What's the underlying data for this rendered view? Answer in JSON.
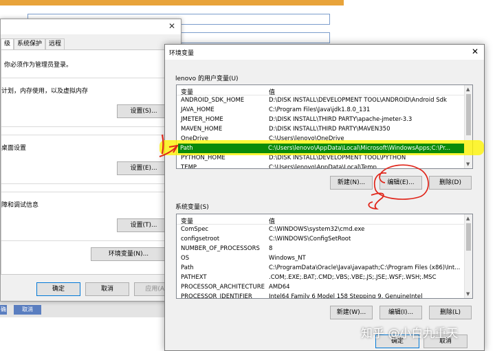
{
  "background": {
    "btn_a": "确",
    "btn_b": "取消"
  },
  "sysprop": {
    "tabs": [
      "级",
      "系统保护",
      "远程"
    ],
    "admin_note": "你必须作为管理员登录。",
    "perf_text": "计划，内存使用，以及虚拟内存",
    "settings1": "设置(S)...",
    "profile_text": "桌面设置",
    "settings2": "设置(E)...",
    "startup_text": "障和调试信息",
    "settings3": "设置(T)...",
    "envvars_btn": "环境变量(N)...",
    "ok": "确定",
    "cancel": "取消",
    "apply": "应用(A)"
  },
  "env": {
    "title": "环境变量",
    "user_label": "lenovo 的用户变量(U)",
    "col_var": "变量",
    "col_val": "值",
    "user_vars": [
      {
        "name": "ANDROID_SDK_HOME",
        "value": "D:\\DISK INSTALL\\DEVELOPMENT TOOL\\ANDROID\\Android Sdk"
      },
      {
        "name": "JAVA_HOME",
        "value": "C:\\Program Files\\Java\\jdk1.8.0_131"
      },
      {
        "name": "JMETER_HOME",
        "value": "D:\\DISK INSTALL\\THIRD PARTY\\apache-jmeter-3.3"
      },
      {
        "name": "MAVEN_HOME",
        "value": "D:\\DISK INSTALL\\THIRD PARTY\\MAVEN350"
      },
      {
        "name": "OneDrive",
        "value": "C:\\Users\\lenovo\\OneDrive"
      },
      {
        "name": "Path",
        "value": "C:\\Users\\lenovo\\AppData\\Local\\Microsoft\\WindowsApps;C:\\Pr..."
      },
      {
        "name": "PYTHON_HOME",
        "value": "D:\\DISK INSTALL\\DEVELOPMENT TOOL\\PYTHON"
      },
      {
        "name": "TEMP",
        "value": "C:\\Users\\lenovo\\AppData\\Local\\Temp"
      }
    ],
    "user_new": "新建(N)...",
    "user_edit": "编辑(E)...",
    "user_delete": "删除(D)",
    "sys_label": "系统变量(S)",
    "sys_vars": [
      {
        "name": "ComSpec",
        "value": "C:\\WINDOWS\\system32\\cmd.exe"
      },
      {
        "name": "configsetroot",
        "value": "C:\\WINDOWS\\ConfigSetRoot"
      },
      {
        "name": "NUMBER_OF_PROCESSORS",
        "value": "8"
      },
      {
        "name": "OS",
        "value": "Windows_NT"
      },
      {
        "name": "Path",
        "value": "C:\\ProgramData\\Oracle\\Java\\javapath;C:\\Program Files (x86)\\Int..."
      },
      {
        "name": "PATHEXT",
        "value": ".COM;.EXE;.BAT;.CMD;.VBS;.VBE;.JS;.JSE;.WSF;.WSH;.MSC"
      },
      {
        "name": "PROCESSOR_ARCHITECTURE",
        "value": "AMD64"
      },
      {
        "name": "PROCESSOR_IDENTIFIER",
        "value": "Intel64 Family 6 Model 158 Stepping 9, GenuineIntel"
      }
    ],
    "sys_new": "新建(W)...",
    "sys_edit": "编辑(I)...",
    "sys_delete": "删除(L)",
    "ok": "确定",
    "cancel": "取消"
  },
  "watermark": "知乎 @小白九重天",
  "colors": {
    "selection": "#0078d7",
    "highlighter": "#fff500",
    "annotation": "#e0261b"
  }
}
